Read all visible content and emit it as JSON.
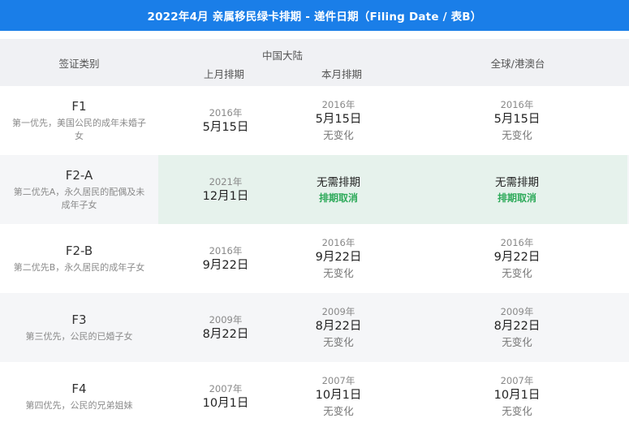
{
  "title": "2022年4月 亲属移民绿卡排期 - 递件日期（Filing Date / 表B）",
  "header": {
    "category": "签证类别",
    "china_group": "中国大陆",
    "last_month": "上月排期",
    "this_month": "本月排期",
    "global": "全球/港澳台"
  },
  "rows": [
    {
      "code": "F1",
      "desc": "第一优先，美国公民的成年未婚子女",
      "last": {
        "year": "2016年",
        "date": "5月15日"
      },
      "this": {
        "year": "2016年",
        "date": "5月15日",
        "note": "无变化"
      },
      "global": {
        "year": "2016年",
        "date": "5月15日",
        "note": "无变化"
      }
    },
    {
      "code": "F2-A",
      "desc": "第二优先A，永久居民的配偶及未成年子女",
      "last": {
        "year": "2021年",
        "date": "12月1日"
      },
      "this": {
        "status": "无需排期",
        "note": "排期取消"
      },
      "global": {
        "status": "无需排期",
        "note": "排期取消"
      }
    },
    {
      "code": "F2-B",
      "desc": "第二优先B，永久居民的成年子女",
      "last": {
        "year": "2016年",
        "date": "9月22日"
      },
      "this": {
        "year": "2016年",
        "date": "9月22日",
        "note": "无变化"
      },
      "global": {
        "year": "2016年",
        "date": "9月22日",
        "note": "无变化"
      }
    },
    {
      "code": "F3",
      "desc": "第三优先，公民的已婚子女",
      "last": {
        "year": "2009年",
        "date": "8月22日"
      },
      "this": {
        "year": "2009年",
        "date": "8月22日",
        "note": "无变化"
      },
      "global": {
        "year": "2009年",
        "date": "8月22日",
        "note": "无变化"
      }
    },
    {
      "code": "F4",
      "desc": "第四优先，公民的兄弟姐妹",
      "last": {
        "year": "2007年",
        "date": "10月1日"
      },
      "this": {
        "year": "2007年",
        "date": "10月1日",
        "note": "无变化"
      },
      "global": {
        "year": "2007年",
        "date": "10月1日",
        "note": "无变化"
      }
    }
  ],
  "colors": {
    "title_bg": "#1a7ee8",
    "highlight_bg": "#e6f2ec",
    "cancel_text": "#2eaa5a"
  }
}
